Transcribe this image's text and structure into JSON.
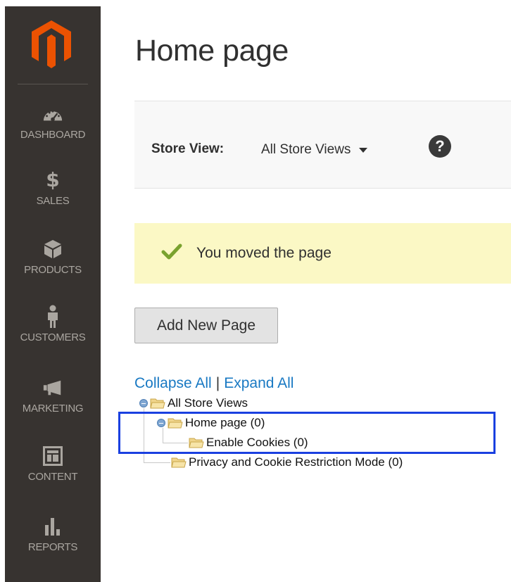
{
  "sidebar": {
    "items": [
      {
        "label": "DASHBOARD",
        "icon": "dashboard-icon"
      },
      {
        "label": "SALES",
        "icon": "dollar-icon",
        "glyph": "$"
      },
      {
        "label": "PRODUCTS",
        "icon": "box-icon"
      },
      {
        "label": "CUSTOMERS",
        "icon": "person-icon"
      },
      {
        "label": "MARKETING",
        "icon": "megaphone-icon"
      },
      {
        "label": "CONTENT",
        "icon": "layout-icon"
      },
      {
        "label": "REPORTS",
        "icon": "bar-chart-icon"
      }
    ]
  },
  "page": {
    "title": "Home page"
  },
  "store_view": {
    "label": "Store View:",
    "selected": "All Store Views",
    "help": "?"
  },
  "message": {
    "text": "You moved the page"
  },
  "actions": {
    "add_new_page": "Add New Page"
  },
  "tree": {
    "collapse_all": "Collapse All",
    "separator": "|",
    "expand_all": "Expand All",
    "nodes": [
      {
        "label": "All Store Views"
      },
      {
        "label": "Home page (0)"
      },
      {
        "label": "Enable Cookies (0)"
      },
      {
        "label": "Privacy and Cookie Restriction Mode (0)"
      }
    ]
  },
  "colors": {
    "sidebar_bg": "#373330",
    "brand_orange": "#eb5202",
    "link_blue": "#1979c3",
    "success_green": "#79a22e",
    "message_bg": "#fbf8c5",
    "highlight": "#1a40e0"
  }
}
